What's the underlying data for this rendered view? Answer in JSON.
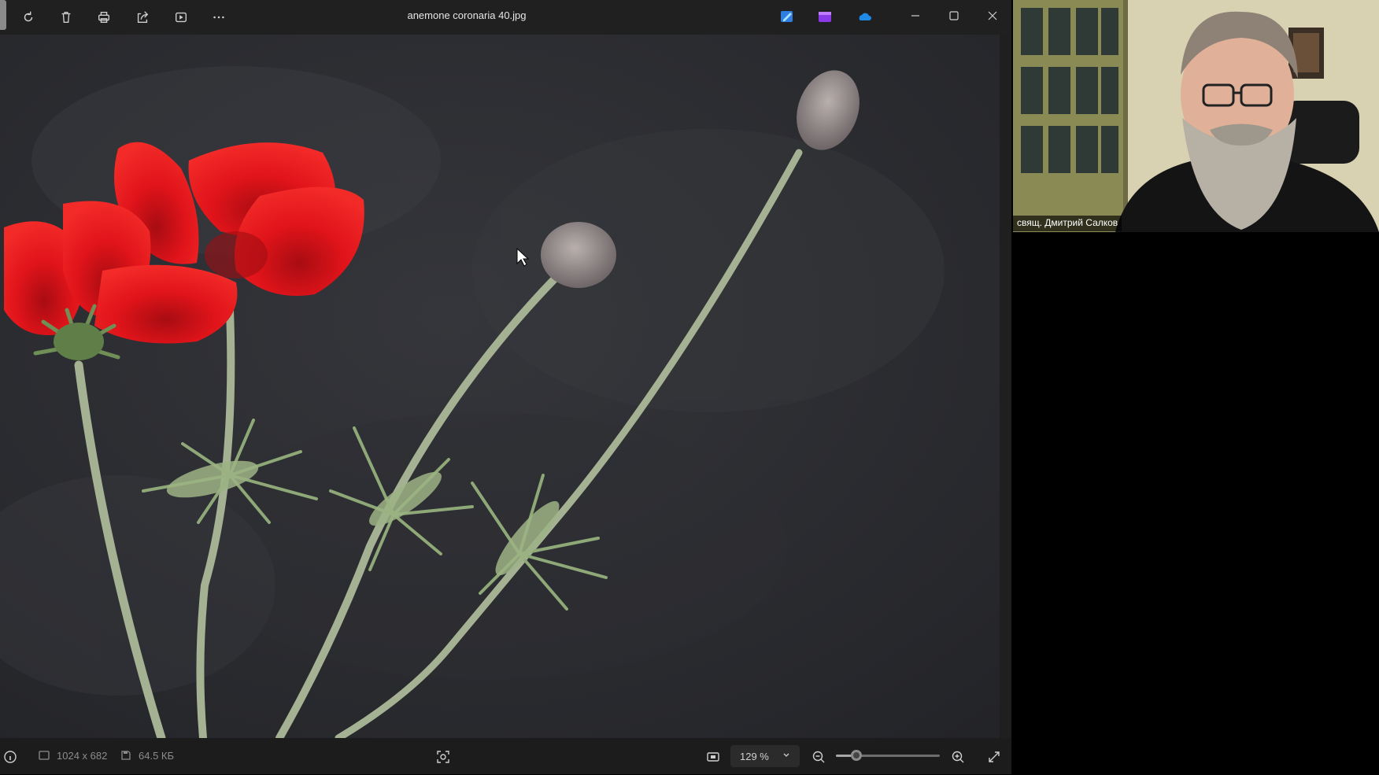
{
  "window": {
    "title": "anemone coronaria 40.jpg"
  },
  "toolbar": {
    "icons": [
      "rotate-icon",
      "delete-icon",
      "print-icon",
      "share-icon",
      "slideshow-icon",
      "more-icon"
    ]
  },
  "status": {
    "dimensions": "1024 x 682",
    "file_size": "64.5 КБ",
    "zoom_value": "129 %",
    "zoom_fraction": 0.2
  },
  "call": {
    "participant_name": "свящ. Дмитрий Салков"
  },
  "colors": {
    "titlebar": "#202020",
    "statusbar": "#1c1c1c",
    "petal_red": "#e0141a",
    "photo_background": "#2a2b2f",
    "stem_green": "#9aa888"
  }
}
